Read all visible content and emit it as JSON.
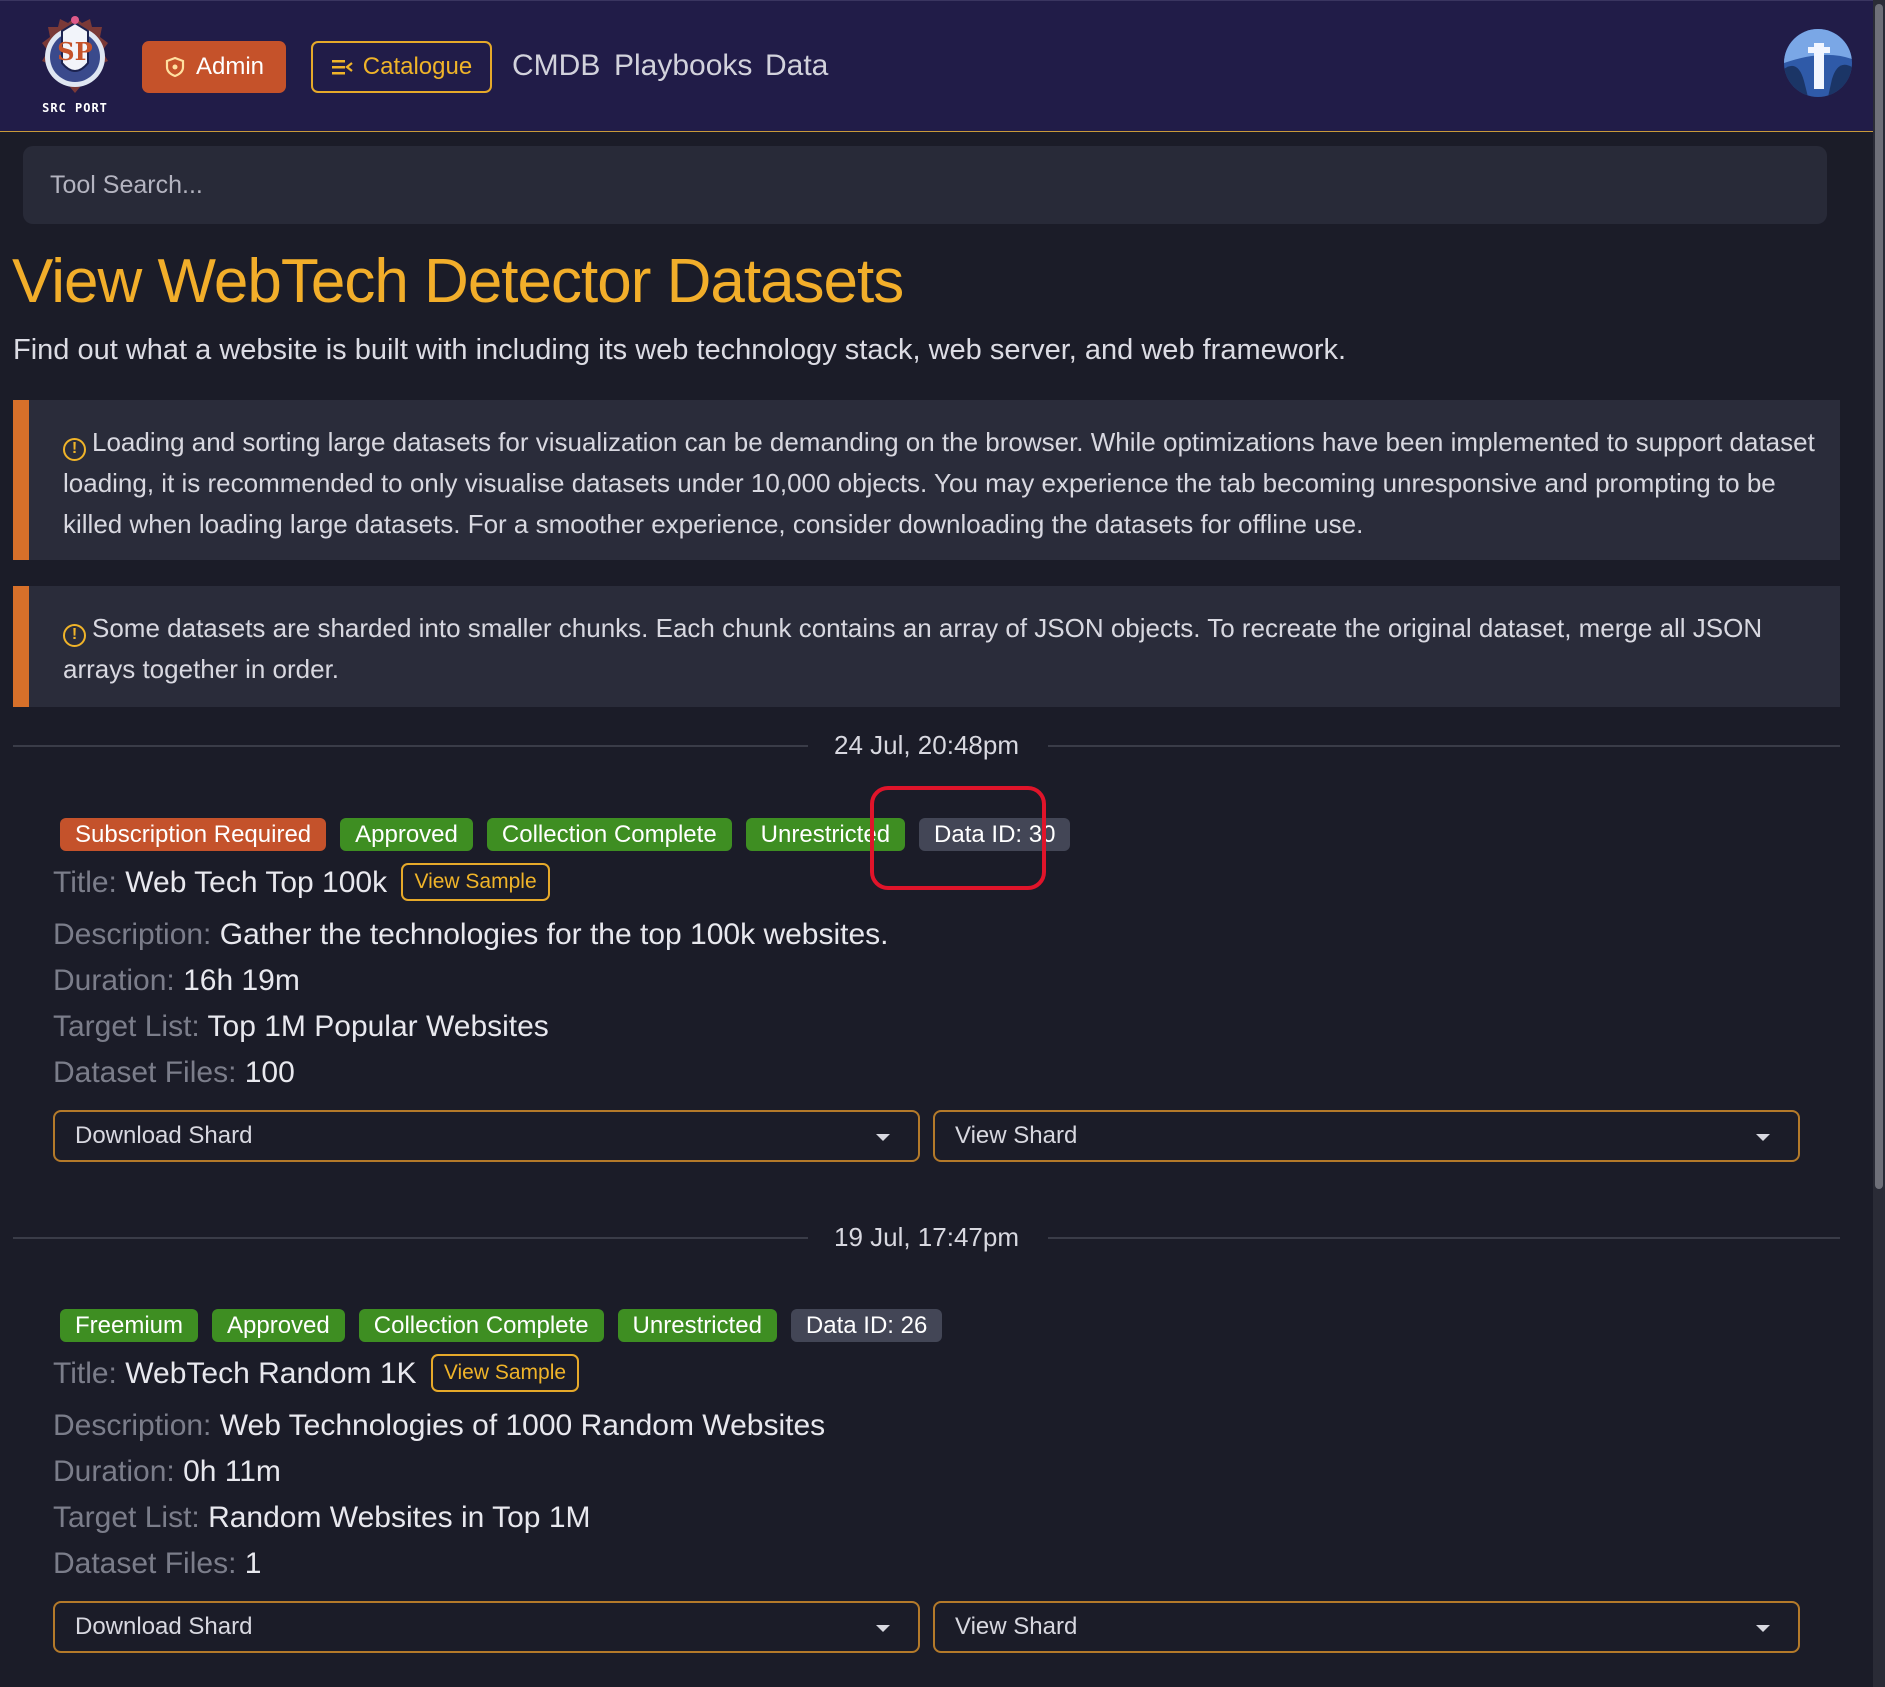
{
  "navbar": {
    "logo_text": "SRC PORT",
    "admin_label": "Admin",
    "catalogue_label": "Catalogue",
    "links": [
      "CMDB",
      "Playbooks",
      "Data"
    ]
  },
  "search": {
    "placeholder": "Tool Search..."
  },
  "page": {
    "title": "View WebTech Detector Datasets",
    "subtitle": "Find out what a website is built with including its web technology stack, web server, and web framework."
  },
  "alerts": [
    "Loading and sorting large datasets for visualization can be demanding on the browser. While optimizations have been implemented to support dataset loading, it is recommended to only visualise datasets under 10,000 objects. You may experience the tab becoming unresponsive and prompting to be killed when loading large datasets. For a smoother experience, consider downloading the datasets for offline use.",
    "Some datasets are sharded into smaller chunks. Each chunk contains an array of JSON objects. To recreate the original dataset, merge all JSON arrays together in order."
  ],
  "labels": {
    "title": "Title:",
    "description": "Description:",
    "duration": "Duration:",
    "target_list": "Target List:",
    "dataset_files": "Dataset Files:",
    "view_sample": "View Sample",
    "download_shard": "Download Shard",
    "view_shard": "View Shard"
  },
  "datasets": [
    {
      "date": "24 Jul, 20:48pm",
      "badges": [
        "Subscription Required",
        "Approved",
        "Collection Complete",
        "Unrestricted",
        "Data ID: 30"
      ],
      "title": "Web Tech Top 100k",
      "description": "Gather the technologies for the top 100k websites.",
      "duration": "16h 19m",
      "target_list": "Top 1M Popular Websites",
      "dataset_files": "100"
    },
    {
      "date": "19 Jul, 17:47pm",
      "badges": [
        "Freemium",
        "Approved",
        "Collection Complete",
        "Unrestricted",
        "Data ID: 26"
      ],
      "title": "WebTech Random 1K",
      "description": "Web Technologies of 1000 Random Websites",
      "duration": "0h 11m",
      "target_list": "Random Websites in Top 1M",
      "dataset_files": "1"
    }
  ],
  "colors": {
    "accent": "#f0b429",
    "navbar": "#211c48",
    "badge_red": "#c4522b",
    "badge_green": "#3e8e22",
    "badge_gray": "#434656",
    "highlight": "#e0142a"
  }
}
